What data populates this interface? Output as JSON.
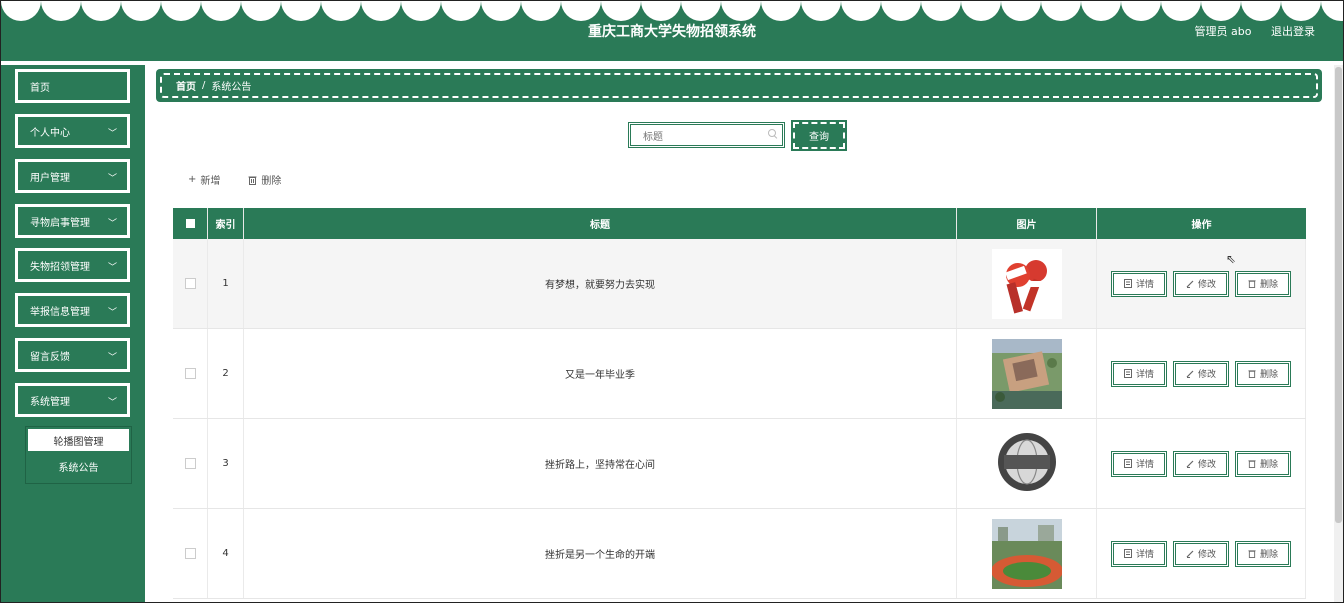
{
  "header": {
    "title": "重庆工商大学失物招领系统",
    "user": "管理员 abo",
    "logout": "退出登录"
  },
  "sidebar": {
    "items": [
      {
        "label": "首页"
      },
      {
        "label": "个人中心"
      },
      {
        "label": "用户管理"
      },
      {
        "label": "寻物启事管理"
      },
      {
        "label": "失物招领管理"
      },
      {
        "label": "举报信息管理"
      },
      {
        "label": "留言反馈"
      },
      {
        "label": "系统管理"
      }
    ],
    "submenu": [
      "轮播图管理",
      "系统公告"
    ]
  },
  "breadcrumb": {
    "home": "首页",
    "current": "系统公告"
  },
  "search": {
    "placeholder": "标题",
    "button": "查询"
  },
  "toolbar": {
    "add": "新增",
    "delete": "删除"
  },
  "table": {
    "headers": [
      "索引",
      "标题",
      "图片",
      "操作"
    ],
    "rows": [
      {
        "index": "1",
        "title": "有梦想，就要努力去实现",
        "image": "news-microphone-image"
      },
      {
        "index": "2",
        "title": "又是一年毕业季",
        "image": "campus-aerial-image"
      },
      {
        "index": "3",
        "title": "挫折路上，坚持常在心间",
        "image": "news-globe-image"
      },
      {
        "index": "4",
        "title": "挫折是另一个生命的开端",
        "image": "sports-field-image"
      }
    ],
    "ops": {
      "detail": "详情",
      "edit": "修改",
      "delete": "删除"
    }
  },
  "colors": {
    "primary": "#2a7a57"
  }
}
